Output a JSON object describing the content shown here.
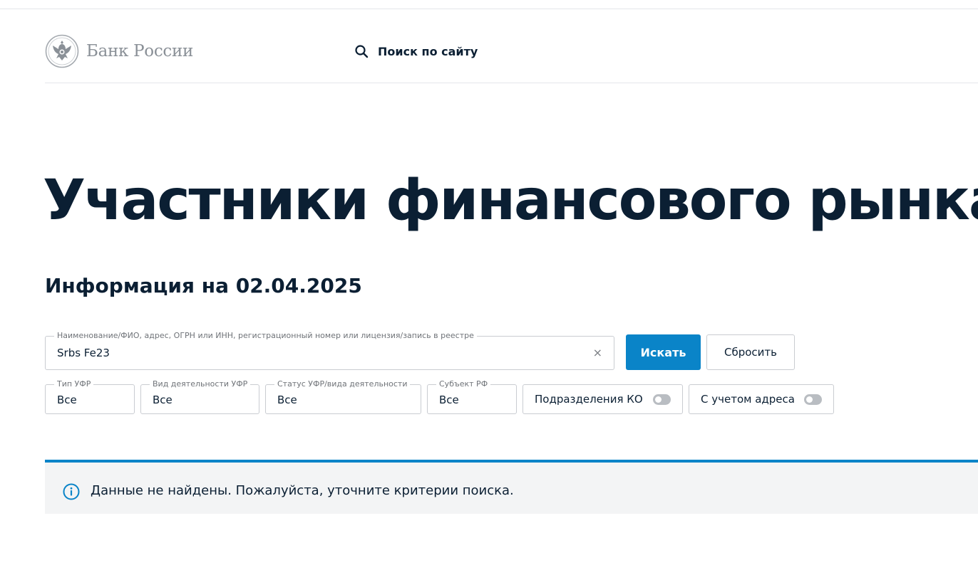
{
  "header": {
    "logo_text": "Банк России",
    "search_label": "Поиск по сайту"
  },
  "page": {
    "title": "Участники финансового рынка",
    "info_date": "Информация на 02.04.2025"
  },
  "search": {
    "field_label": "Наименование/ФИО, адрес, ОГРН или ИНН, регистрационный номер или лицензия/запись в реестре",
    "value": "Srbs Fe23",
    "clear_symbol": "×",
    "submit_label": "Искать",
    "reset_label": "Сбросить"
  },
  "filters": [
    {
      "label": "Тип УФР",
      "value": "Все"
    },
    {
      "label": "Вид деятельности УФР",
      "value": "Все"
    },
    {
      "label": "Статус УФР/вида деятельности",
      "value": "Все"
    },
    {
      "label": "Субъект РФ",
      "value": "Все"
    }
  ],
  "toggles": [
    {
      "label": "Подразделения КО",
      "on": false
    },
    {
      "label": "С учетом адреса",
      "on": false
    }
  ],
  "notice": {
    "text": "Данные не найдены. Пожалуйста, уточните критерии поиска."
  },
  "colors": {
    "accent": "#0a84c8",
    "text": "#0b1f33",
    "notice_bg": "#f3f4f5"
  }
}
